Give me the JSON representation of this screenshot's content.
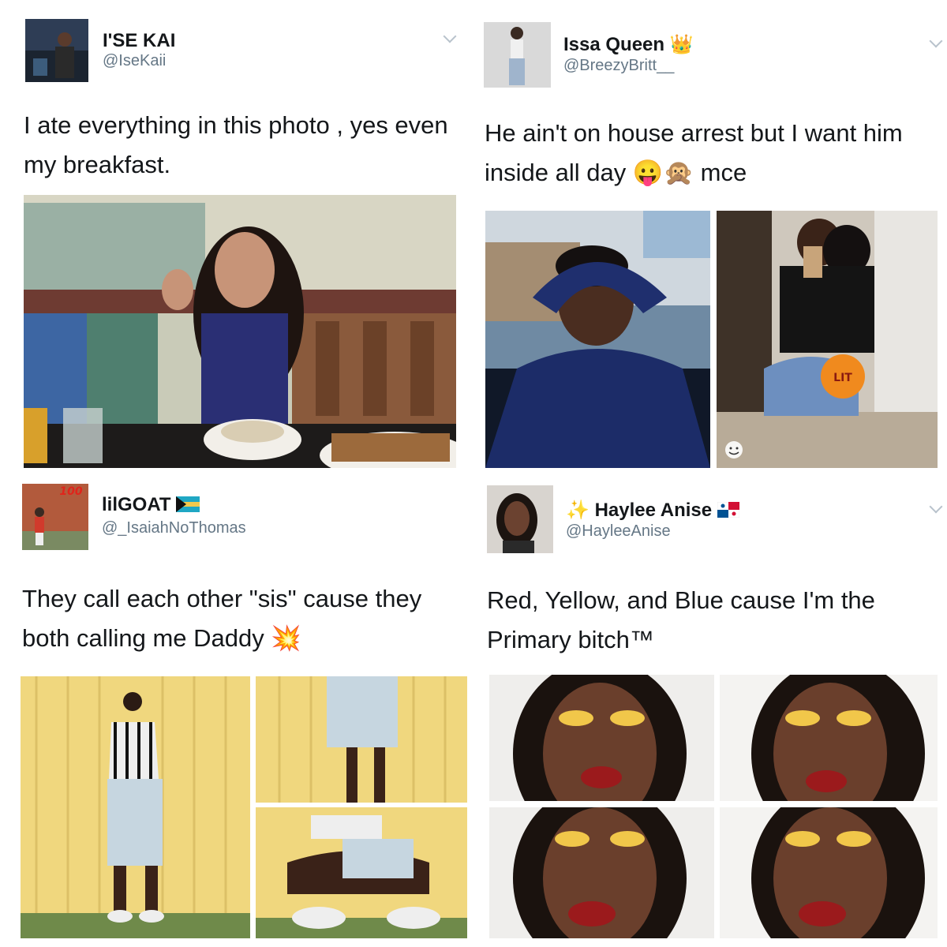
{
  "tweets": [
    {
      "name": "I'SE KAI",
      "handle": "@IseKaii",
      "text": "I ate everything in this photo , yes even my breakfast."
    },
    {
      "name": "Issa Queen",
      "name_emoji": "👑",
      "handle": "@BreezyBritt__",
      "text": "He ain't on house arrest but I want him inside all day",
      "text_emoji": "😛🙊",
      "text_suffix": "mce",
      "sticker": "LIT"
    },
    {
      "name": "lilGOAT",
      "name_flag": "bahamas-flag",
      "handle": "@_IsaiahNoThomas",
      "text": "They call each other \"sis\" cause they both calling me Daddy",
      "text_emoji": "💥",
      "avatar_badge": "100"
    },
    {
      "name_prefix_emoji": "✨",
      "name": "Haylee Anise",
      "name_flag": "panama-flag",
      "handle": "@HayleeAnise",
      "text": "Red, Yellow, and Blue cause I'm the Primary bitch™"
    }
  ],
  "colors": {
    "name": "#14171a",
    "handle": "#657786",
    "chevron": "#b8c2cc"
  }
}
